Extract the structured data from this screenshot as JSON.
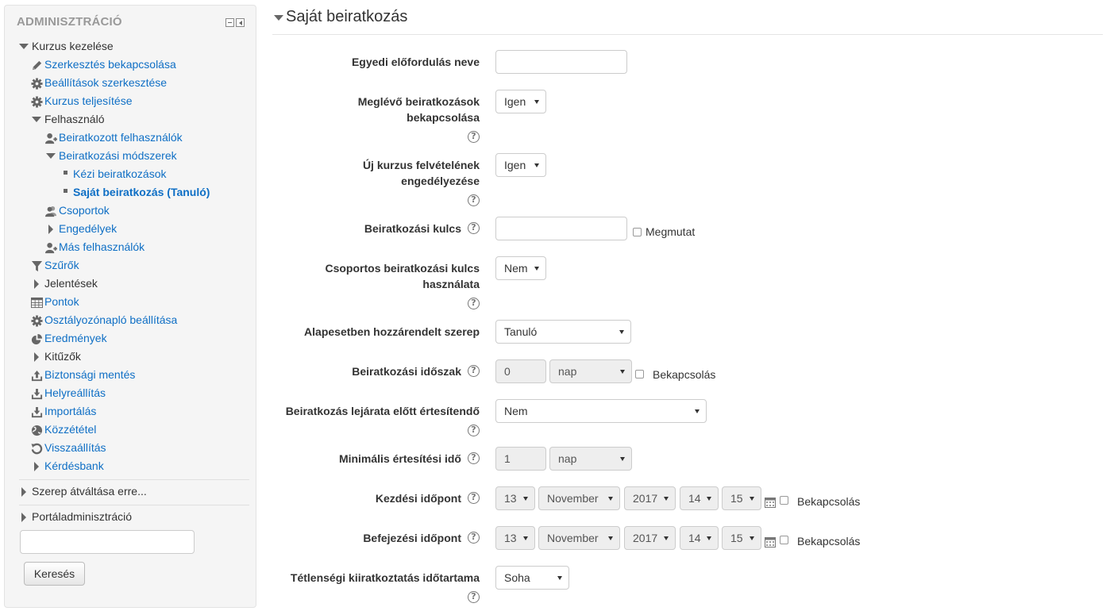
{
  "sidebar": {
    "title": "ADMINISZTRÁCIÓ",
    "items": [
      {
        "label": "Kurzus kezelése",
        "icon": "tri-down"
      },
      {
        "label": "Szerkesztés bekapcsolása",
        "icon": "pencil"
      },
      {
        "label": "Beállítások szerkesztése",
        "icon": "gear"
      },
      {
        "label": "Kurzus teljesítése",
        "icon": "gear"
      },
      {
        "label": "Felhasználó",
        "icon": "tri-down"
      },
      {
        "label": "Beiratkozott felhasználók",
        "icon": "user-plus"
      },
      {
        "label": "Beiratkozási módszerek",
        "icon": "tri-down"
      },
      {
        "label": "Kézi beiratkozások",
        "icon": "bullet"
      },
      {
        "label": "Saját beiratkozás (Tanuló)",
        "icon": "bullet"
      },
      {
        "label": "Csoportok",
        "icon": "users"
      },
      {
        "label": "Engedélyek",
        "icon": "tri-right"
      },
      {
        "label": "Más felhasználók",
        "icon": "user-plus"
      },
      {
        "label": "Szűrők",
        "icon": "filter"
      },
      {
        "label": "Jelentések",
        "icon": "tri-right"
      },
      {
        "label": "Pontok",
        "icon": "table"
      },
      {
        "label": "Osztályozónapló beállítása",
        "icon": "gear"
      },
      {
        "label": "Eredmények",
        "icon": "chart-pie"
      },
      {
        "label": "Kitűzők",
        "icon": "tri-right"
      },
      {
        "label": "Biztonsági mentés",
        "icon": "upload"
      },
      {
        "label": "Helyreállítás",
        "icon": "download"
      },
      {
        "label": "Importálás",
        "icon": "download"
      },
      {
        "label": "Közzététel",
        "icon": "globe"
      },
      {
        "label": "Visszaállítás",
        "icon": "reset"
      },
      {
        "label": "Kérdésbank",
        "icon": "tri-right"
      }
    ],
    "role_switch": "Szerep átváltása erre...",
    "site_admin": "Portáladminisztráció",
    "search_button": "Keresés"
  },
  "main": {
    "section_title": "Saját beiratkozás",
    "fields": {
      "instance_name": {
        "label": "Egyedi előfordulás neve",
        "value": ""
      },
      "allow_existing": {
        "label_line1": "Meglévő beiratkozások",
        "label_line2": "bekapcsolása",
        "value": "Igen"
      },
      "allow_new": {
        "label_line1": "Új kurzus felvételének",
        "label_line2": "engedélyezése",
        "value": "Igen"
      },
      "enrol_key": {
        "label": "Beiratkozási kulcs",
        "value": "",
        "show_label": "Megmutat"
      },
      "group_key": {
        "label_line1": "Csoportos beiratkozási kulcs",
        "label_line2": "használata",
        "value": "Nem"
      },
      "default_role": {
        "label": "Alapesetben hozzárendelt szerep",
        "value": "Tanuló"
      },
      "enrol_period": {
        "label": "Beiratkozási időszak",
        "value": "0",
        "unit": "nap",
        "enable_label": "Bekapcsolás"
      },
      "expiry_notify": {
        "label": "Beiratkozás lejárata előtt értesítendő",
        "value": "Nem"
      },
      "expiry_threshold": {
        "label": "Minimális értesítési idő",
        "value": "1",
        "unit": "nap"
      },
      "start_date": {
        "label": "Kezdési időpont",
        "day": "13",
        "month": "November",
        "year": "2017",
        "hour": "14",
        "minute": "15",
        "enable_label": "Bekapcsolás"
      },
      "end_date": {
        "label": "Befejezési időpont",
        "day": "13",
        "month": "November",
        "year": "2017",
        "hour": "14",
        "minute": "15",
        "enable_label": "Bekapcsolás"
      },
      "inactivity": {
        "label": "Tétlenségi kiiratkoztatás időtartama",
        "value": "Soha"
      }
    },
    "help_glyph": "?"
  },
  "colors": {
    "link": "#0f6fc5",
    "sidebar_bg": "#f5f5f5",
    "disabled_bg": "#eeeeee"
  }
}
